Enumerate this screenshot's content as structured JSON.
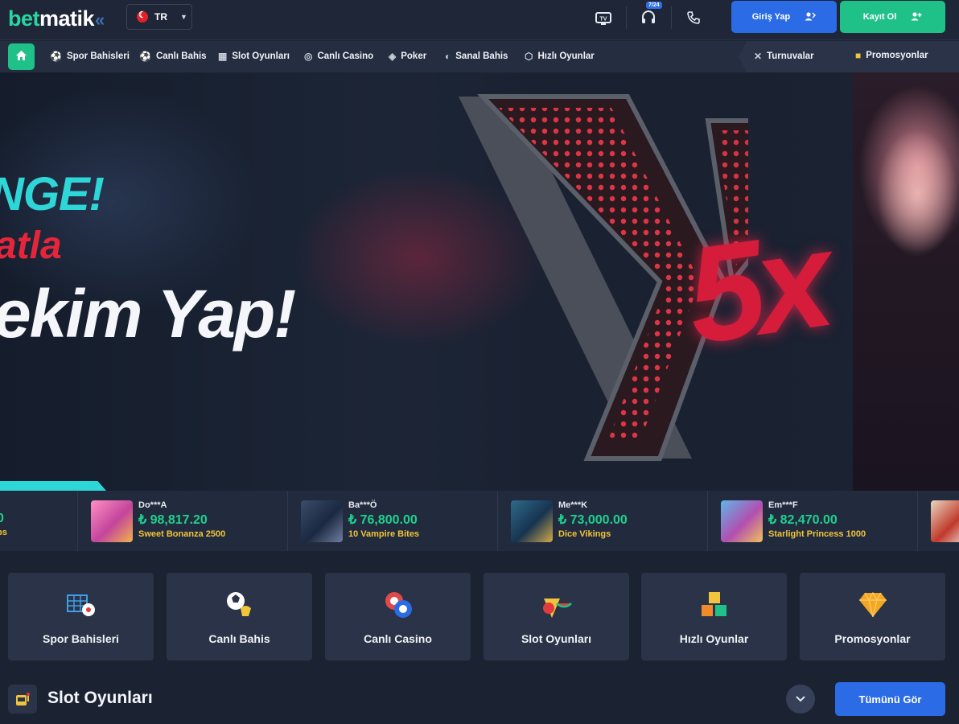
{
  "header": {
    "logo_part1": "bet",
    "logo_part2": "matik",
    "logo_chevrons": "«",
    "language": "TR",
    "support_badge": "7/24",
    "login_label": "Giriş Yap",
    "register_label": "Kayıt Ol"
  },
  "nav": {
    "items": [
      {
        "label": "Spor Bahisleri",
        "icon": "soccer-ball-icon"
      },
      {
        "label": "Canlı Bahis",
        "icon": "live-bet-icon"
      },
      {
        "label": "Slot Oyunları",
        "icon": "slot-machine-icon"
      },
      {
        "label": "Canlı Casino",
        "icon": "casino-chip-icon"
      },
      {
        "label": "Poker",
        "icon": "poker-chip-icon"
      },
      {
        "label": "Sanal Bahis",
        "icon": "virtual-bet-icon"
      },
      {
        "label": "Hızlı Oyunlar",
        "icon": "dice-icon"
      }
    ],
    "right_items": [
      {
        "label": "Turnuvalar",
        "icon": "swords-icon"
      },
      {
        "label": "Promosyonlar",
        "icon": "gift-icon"
      }
    ]
  },
  "hero": {
    "line1": "NGE!",
    "line2": "atla",
    "line3": "ekim Yap!",
    "multiplier": "5x"
  },
  "winners": {
    "partial_left_amount": "0",
    "partial_left_game": "bs",
    "items": [
      {
        "user": "Do***A",
        "amount": "₺ 98,817.20",
        "game": "Sweet Bonanza 2500"
      },
      {
        "user": "Ba***Ö",
        "amount": "₺ 76,800.00",
        "game": "10 Vampire Bites"
      },
      {
        "user": "Me***K",
        "amount": "₺ 73,000.00",
        "game": "Dice Vikings"
      },
      {
        "user": "Em***F",
        "amount": "₺ 82,470.00",
        "game": "Starlight Princess 1000"
      }
    ]
  },
  "categories": [
    {
      "label": "Spor Bahisleri"
    },
    {
      "label": "Canlı Bahis"
    },
    {
      "label": "Canlı Casino"
    },
    {
      "label": "Slot Oyunları"
    },
    {
      "label": "Hızlı Oyunlar"
    },
    {
      "label": "Promosyonlar"
    }
  ],
  "section": {
    "title": "Slot Oyunları",
    "view_all_label": "Tümünü Gör"
  },
  "colors": {
    "background": "#1b2333",
    "accent_green": "#1fc189",
    "accent_blue": "#2c6be6",
    "card": "#2a3347",
    "win_amount": "#1fd08e",
    "win_game": "#f0c43c"
  }
}
